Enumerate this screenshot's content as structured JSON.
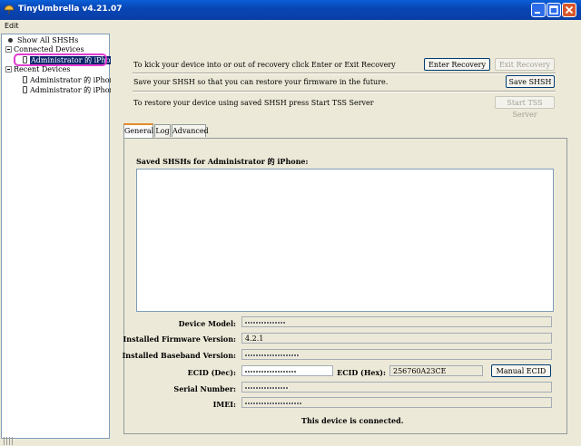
{
  "window": {
    "title": "TinyUmbrella v4.21.07"
  },
  "menu": {
    "edit": "Edit"
  },
  "tree": {
    "show_all": "Show All SHSHs",
    "connected_group": "Connected Devices",
    "connected_device": "Administrator 的 iPhone",
    "recent_group": "Recent Devices",
    "recent_devices": [
      "Administrator 的 iPhone",
      "Administrator 的 iPhone"
    ]
  },
  "recovery": {
    "line1": "To kick your device into or out of recovery click Enter or Exit Recovery",
    "enter_label": "Enter Recovery",
    "exit_label": "Exit Recovery",
    "line2": "Save your SHSH so that you can restore your firmware in the future.",
    "save_label": "Save SHSH",
    "line3": "To restore your device using saved SHSH press Start TSS Server",
    "tss_label": "Start TSS Server"
  },
  "tabs": [
    "General",
    "Log",
    "Advanced"
  ],
  "general": {
    "saved_title": "Saved SHSHs for Administrator 的 iPhone:",
    "device_model_label": "Device Model:",
    "firmware_label": "Installed Firmware Version:",
    "firmware_value": "4.2.1",
    "baseband_label": "Installed Baseband Version:",
    "ecid_dec_label": "ECID (Dec):",
    "ecid_hex_label": "ECID (Hex):",
    "ecid_hex_value": "256760A23CE",
    "manual_ecid_label": "Manual ECID",
    "serial_label": "Serial Number:",
    "imei_label": "IMEI:",
    "status": "This device is connected."
  },
  "colors": {
    "title_bar": "#0846b5",
    "selection": "#0a246a",
    "highlight_circle": "#e23cd0",
    "tab_accent": "#e68b2c"
  }
}
